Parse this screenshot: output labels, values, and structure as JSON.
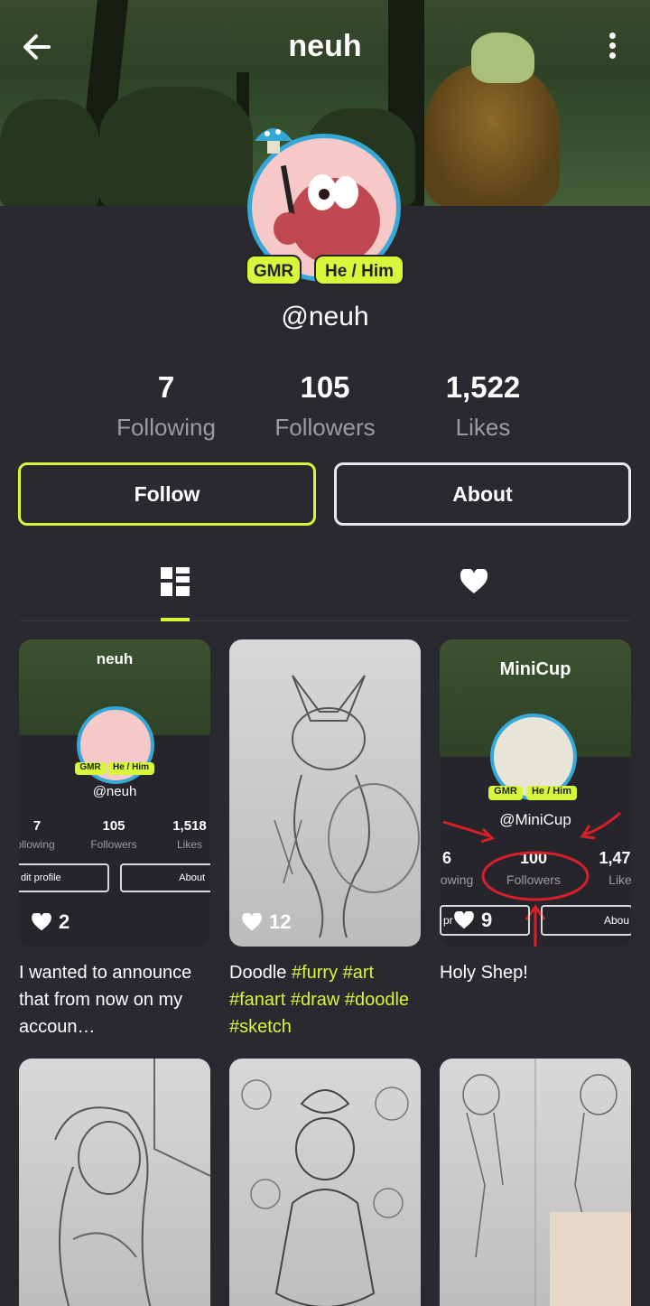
{
  "header": {
    "title": "neuh"
  },
  "profile": {
    "handle": "@neuh",
    "badges": [
      "GMR",
      "He / Him"
    ]
  },
  "stats": [
    {
      "value": "7",
      "label": "Following"
    },
    {
      "value": "105",
      "label": "Followers"
    },
    {
      "value": "1,522",
      "label": "Likes"
    }
  ],
  "actions": {
    "follow": "Follow",
    "about": "About"
  },
  "posts": [
    {
      "likes": "2",
      "caption_text": "I wanted to announce that from now on my accoun…",
      "thumb": {
        "title": "neuh",
        "badges": [
          "GMR",
          "He / Him"
        ],
        "handle": "@neuh",
        "stats": [
          {
            "value": "7",
            "label": "ollowing"
          },
          {
            "value": "105",
            "label": "Followers"
          },
          {
            "value": "1,518",
            "label": "Likes"
          }
        ],
        "buttons": [
          "dit profile",
          "About"
        ]
      }
    },
    {
      "likes": "12",
      "caption_text": "Doodle",
      "caption_tags": [
        "#furry",
        "#art",
        "#fanart",
        "#draw",
        "#doodle",
        "#sketch"
      ]
    },
    {
      "likes": "9",
      "caption_text": "Holy Shep!",
      "thumb": {
        "title": "MiniCup",
        "badges": [
          "GMR",
          "He / Him"
        ],
        "handle": "@MiniCup",
        "stats": [
          {
            "value": "6",
            "label": "owing"
          },
          {
            "value": "100",
            "label": "Followers"
          },
          {
            "value": "1,47",
            "label": "Like"
          }
        ],
        "buttons": [
          "pr",
          "Abou"
        ]
      }
    }
  ],
  "colors": {
    "accent": "#d6f73a",
    "background": "#2a2930",
    "ring": "#36a8d8"
  }
}
